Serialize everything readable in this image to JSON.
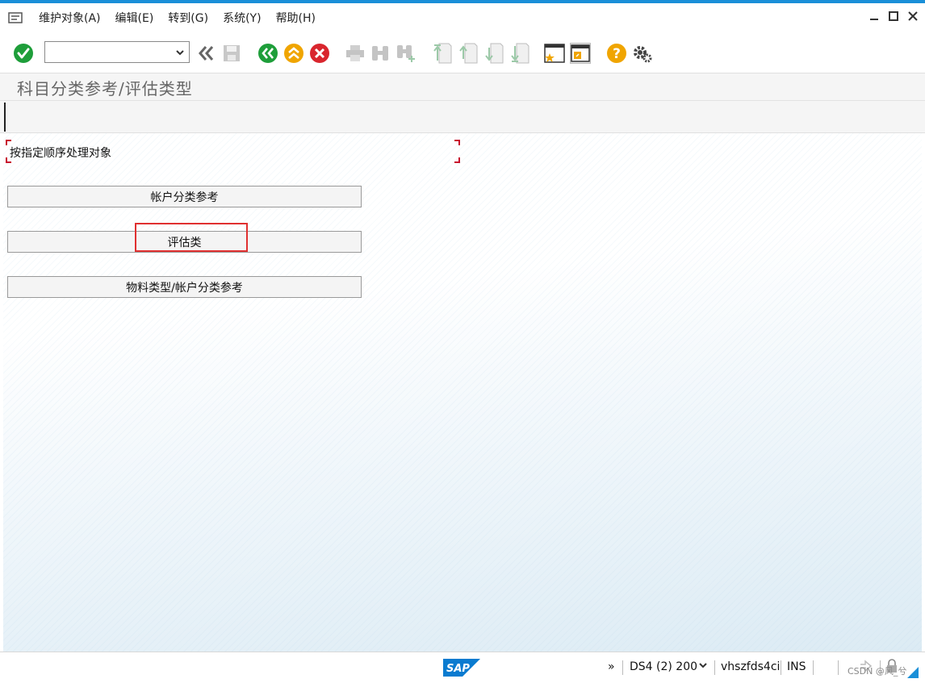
{
  "menu": {
    "items": [
      {
        "label": "维护对象(A)"
      },
      {
        "label": "编辑(E)"
      },
      {
        "label": "转到(G)"
      },
      {
        "label": "系统(Y)"
      },
      {
        "label": "帮助(H)"
      }
    ]
  },
  "toolbar": {
    "command_value": "",
    "icons": [
      "enter-icon",
      "command-field",
      "back-double-icon",
      "save-icon",
      "back-icon",
      "exit-icon",
      "cancel-icon",
      "print-icon",
      "find-icon",
      "find-next-icon",
      "first-page-icon",
      "previous-page-icon",
      "next-page-icon",
      "last-page-icon",
      "create-session-icon",
      "shortcut-icon",
      "help-icon",
      "settings-icon"
    ]
  },
  "page": {
    "title": "科目分类参考/评估类型"
  },
  "content": {
    "frame_label": "按指定顺序处理对象",
    "buttons": [
      {
        "label": "帐户分类参考"
      },
      {
        "label": "评估类"
      },
      {
        "label": "物料类型/帐户分类参考"
      }
    ]
  },
  "status": {
    "chevron": "»",
    "system": "DS4 (2) 200",
    "server": "vhszfds4ci",
    "mode": "INS",
    "watermark": "CSDN @风_兮"
  },
  "colors": {
    "accent": "#1a8fd8",
    "ok_green": "#1e9e3a",
    "exit_orange": "#f0a500",
    "cancel_red": "#d9262e",
    "highlight_red": "#e03030",
    "sap_blue": "#0a7bd0"
  }
}
